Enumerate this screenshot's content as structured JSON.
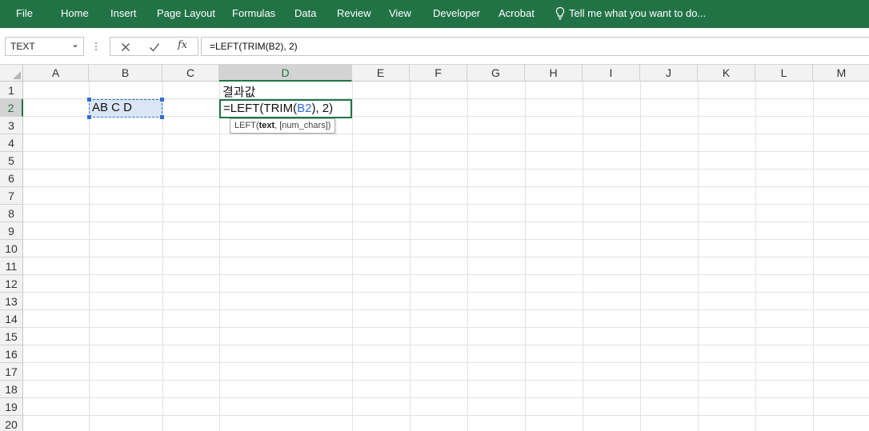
{
  "ribbon": {
    "tabs": [
      "File",
      "Home",
      "Insert",
      "Page Layout",
      "Formulas",
      "Data",
      "Review",
      "View",
      "Developer",
      "Acrobat"
    ],
    "tell_me": "Tell me what you want to do...",
    "tell_me_icon": "lightbulb-icon",
    "color": "#217346"
  },
  "formula_bar": {
    "name_box": "TEXT",
    "cancel_icon": "close-icon",
    "enter_icon": "checkmark-icon",
    "fx_label": "fx",
    "formula": "=LEFT(TRIM(B2), 2)"
  },
  "sheet": {
    "columns": [
      "A",
      "B",
      "C",
      "D",
      "E",
      "F",
      "G",
      "H",
      "I",
      "J",
      "K",
      "L",
      "M"
    ],
    "rows": [
      "1",
      "2",
      "3",
      "4",
      "5",
      "6",
      "7",
      "8",
      "9",
      "10",
      "11",
      "12",
      "13",
      "14",
      "15",
      "16",
      "17",
      "18",
      "19",
      "20"
    ],
    "selected_column": "D",
    "selected_row": "2",
    "cells": {
      "D1": "결과값",
      "B2": "AB C D"
    },
    "edit_cell": {
      "ref": "D2",
      "parts": [
        "=LEFT(TRIM(",
        "B2",
        "), 2)"
      ]
    },
    "tooltip": {
      "fn": "LEFT(",
      "arg_bold": "text",
      "rest": ", [num_chars])"
    },
    "ref_color": "#2f6fce",
    "paren_color": "#c0392b"
  }
}
